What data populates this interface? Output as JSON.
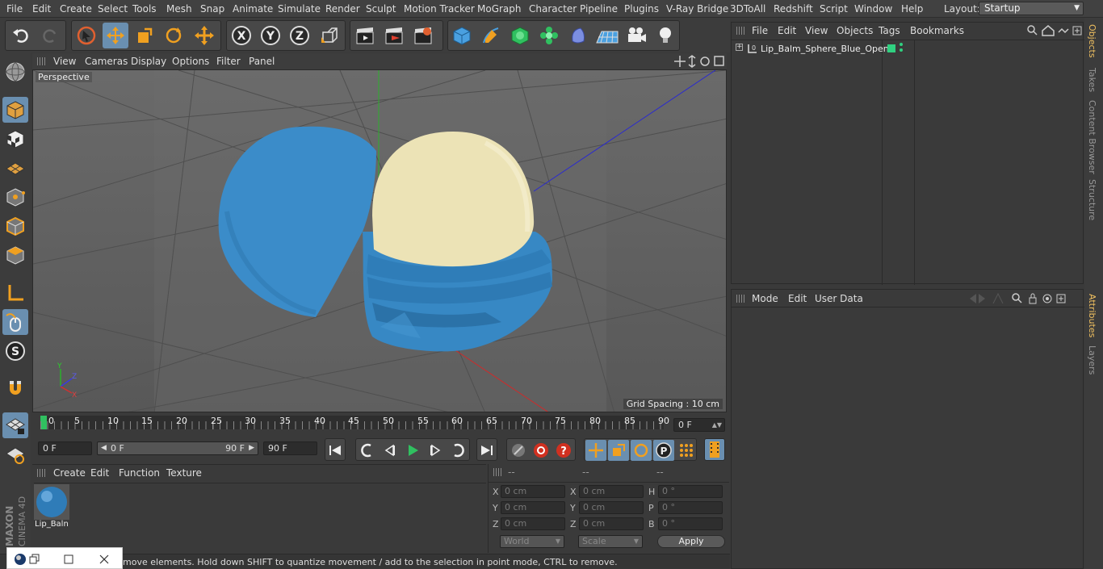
{
  "menubar": {
    "items": [
      "File",
      "Edit",
      "Create",
      "Select",
      "Tools",
      "Mesh",
      "Snap",
      "Animate",
      "Simulate",
      "Render",
      "Sculpt",
      "Motion Tracker",
      "MoGraph",
      "Character",
      "Pipeline",
      "Plugins",
      "V-Ray Bridge",
      "3DToAll",
      "Redshift",
      "Script",
      "Window",
      "Help"
    ],
    "layout_label": "Layout:",
    "layout_value": "Startup"
  },
  "viewport": {
    "menu": [
      "View",
      "Cameras",
      "Display",
      "Options",
      "Filter",
      "Panel"
    ],
    "label": "Perspective",
    "grid_spacing": "Grid Spacing : 10 cm"
  },
  "timeline": {
    "ticks": [
      "0",
      "5",
      "10",
      "15",
      "20",
      "25",
      "30",
      "35",
      "40",
      "45",
      "50",
      "55",
      "60",
      "65",
      "70",
      "75",
      "80",
      "85",
      "90"
    ],
    "current_frame": "0 F"
  },
  "playbar": {
    "start": "0 F",
    "range_start": "0 F",
    "range_end": "90 F",
    "end": "90 F"
  },
  "materials": {
    "menu": [
      "Create",
      "Edit",
      "Function",
      "Texture"
    ],
    "items": [
      {
        "name": "Lip_Baln"
      }
    ]
  },
  "coords": {
    "headers": [
      "--",
      "--",
      "--"
    ],
    "rows": [
      {
        "a": "X",
        "av": "0 cm",
        "b": "X",
        "bv": "0 cm",
        "c": "H",
        "cv": "0 °"
      },
      {
        "a": "Y",
        "av": "0 cm",
        "b": "Y",
        "bv": "0 cm",
        "c": "P",
        "cv": "0 °"
      },
      {
        "a": "Z",
        "av": "0 cm",
        "b": "Z",
        "bv": "0 cm",
        "c": "B",
        "cv": "0 °"
      }
    ],
    "space": "World",
    "mode": "Scale",
    "apply": "Apply"
  },
  "objects": {
    "menu": [
      "File",
      "Edit",
      "View",
      "Objects",
      "Tags",
      "Bookmarks"
    ],
    "items": [
      {
        "name": "Lip_Balm_Sphere_Blue_Open"
      }
    ]
  },
  "attributes": {
    "menu": [
      "Mode",
      "Edit",
      "User Data"
    ]
  },
  "right_tabs": [
    "Objects",
    "Takes",
    "Content Browser",
    "Structure",
    "Attributes",
    "Layers"
  ],
  "branding": {
    "maxon": "MAXON",
    "product": "CINEMA 4D"
  },
  "status": "move elements. Hold down SHIFT to quantize movement / add to the selection in point mode, CTRL to remove.",
  "colors": {
    "accent": "#6a8fb0",
    "object_blue": "#3b8cc9",
    "cream": "#ece3b6"
  }
}
